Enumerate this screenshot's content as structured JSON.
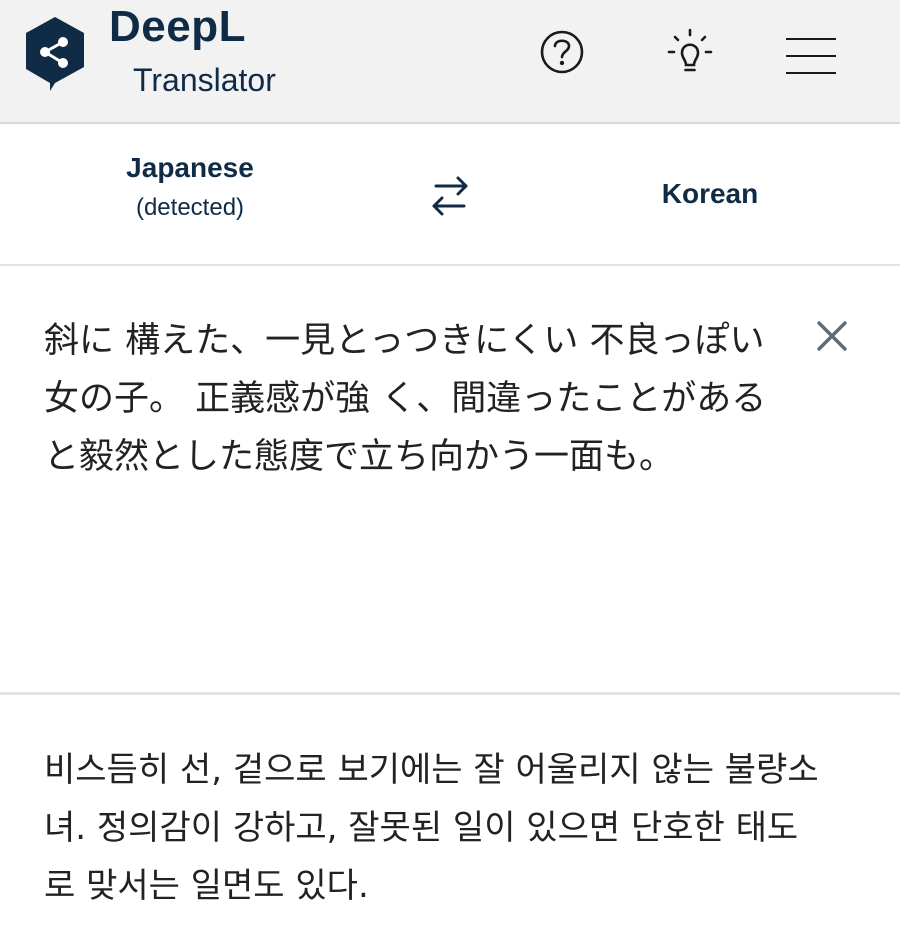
{
  "header": {
    "brand_name": "DeepL",
    "brand_sub": "Translator",
    "icons": {
      "logo": "deepl-logo-icon",
      "help": "question-circle-icon",
      "tips": "lightbulb-icon",
      "menu": "hamburger-menu-icon"
    },
    "brand_color": "#0f2b46"
  },
  "languages": {
    "source_name": "Japanese",
    "source_note": "(detected)",
    "target_name": "Korean",
    "swap_icon": "swap-arrows-icon"
  },
  "source": {
    "text": "斜に 構えた、一見とっつきにくい 不良っぽい 女の子。 正義感が強 く、間違ったことがあると毅然とした態度で立ち向かう一面も。",
    "clear_icon": "close-icon"
  },
  "target": {
    "text": "비스듬히 선, 겉으로 보기에는 잘 어울리지 않는 불량소녀. 정의감이 강하고, 잘못된 일이 있으면 단호한 태도로 맞서는 일면도 있다."
  }
}
